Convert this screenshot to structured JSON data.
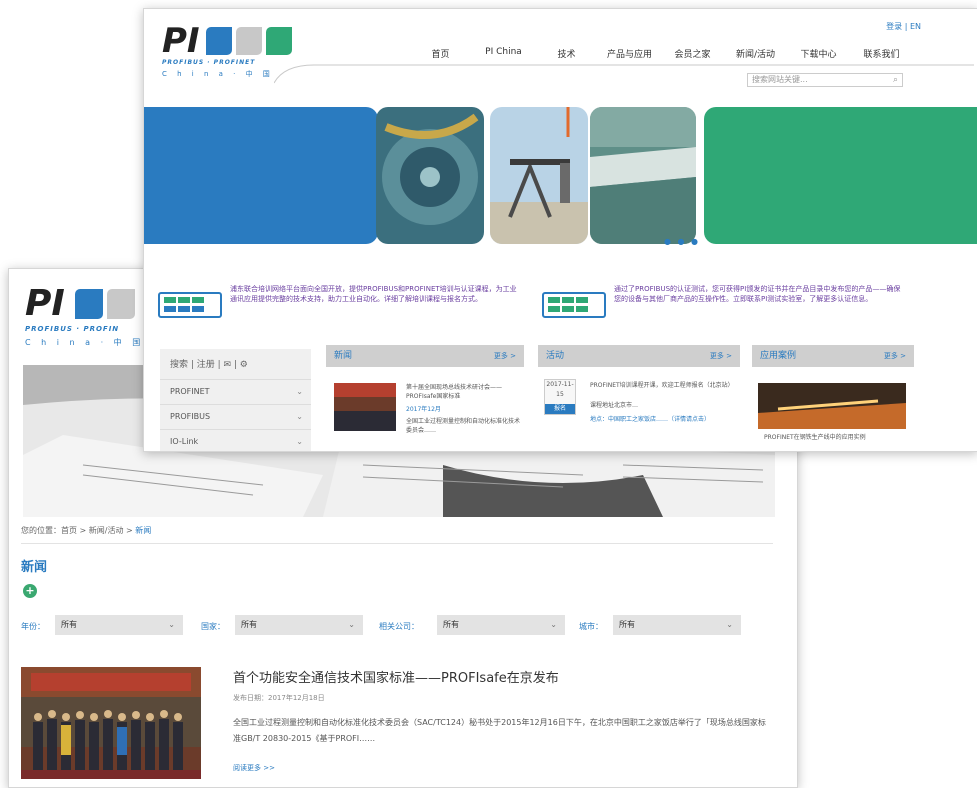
{
  "colors": {
    "brand_blue": "#2a7bc0",
    "brand_green": "#2fa876",
    "gray": "#c8c8c8",
    "purple_text": "#6a3fa0"
  },
  "back": {
    "logo": {
      "mark": "PI",
      "sub": "PROFIBUS · PROFIN",
      "cn": "C h i n a · 中 国"
    },
    "breadcrumb": {
      "prefix": "您的位置：",
      "home": "首页",
      "sep1": " > ",
      "section": "新闻/活动",
      "sep2": " > ",
      "current": "新闻"
    },
    "section_title": "新闻",
    "add_icon": "plus-icon",
    "filters": [
      {
        "label": "年份：",
        "value": "所有"
      },
      {
        "label": "国家：",
        "value": "所有"
      },
      {
        "label": "相关公司：",
        "value": "所有"
      },
      {
        "label": "城市：",
        "value": "所有"
      }
    ],
    "article": {
      "title": "首个功能安全通信技术国家标准——PROFIsafe在京发布",
      "date": "发布日期：2017年12月18日",
      "body": "全国工业过程测量控制和自动化标准化技术委员会（SAC/TC124）秘书处于2015年12月16日下午，在北京中国职工之家饭店举行了「现场总线国家标准GB/T 20830-2015《基于PROFI……",
      "more": "阅读更多 >>"
    }
  },
  "front": {
    "logo": {
      "mark": "PI",
      "sub": "PROFIBUS · PROFINET",
      "cn": "C h i n a · 中 国"
    },
    "top_links": {
      "login": "登录",
      "sep": " | ",
      "english": "EN"
    },
    "nav": [
      "首页",
      "PI China",
      "技术",
      "产品与应用",
      "会员之家",
      "新闻/活动",
      "下载中心",
      "联系我们"
    ],
    "search": {
      "placeholder": "搜索网站关键...",
      "icon": "search-icon"
    },
    "banner_dots": "● ● ●",
    "promo_left": "浦东联合培训网络平台面向全国开放，提供PROFIBUS和PROFINET培训与认证课程，为工业通讯应用提供完整的技术支持，助力工业自动化。详细了解培训课程与报名方式。",
    "promo_right": "通过了PROFIBUS的认证测试，您可获得PI颁发的证书并在产品目录中发布您的产品——确保您的设备与其他厂商产品的互操作性。立即联系PI测试实验室，了解更多认证信息。",
    "sidebar": {
      "tools": "搜索 | 注册 | ✉ | ⚙",
      "items": [
        "PROFINET",
        "PROFIBUS",
        "IO-Link"
      ]
    },
    "columns": [
      {
        "title": "新闻",
        "more": "更多 >"
      },
      {
        "title": "活动",
        "more": "更多 >"
      },
      {
        "title": "应用案例",
        "more": "更多 >"
      }
    ],
    "news_item": {
      "title": "第十届全国现场总线技术研讨会——PROFIsafe国家标准",
      "date": "2017年12月",
      "desc": "全国工业过程测量控制和自动化标准化技术委员会……"
    },
    "event_item": {
      "date": "2017-11-15",
      "tag": "报名",
      "title": "PROFINET培训课程开课，欢迎工程师报名（北京站）",
      "sub": "课程地址北京市…",
      "desc": "地点：中国职工之家饭店……（详情请点击）"
    },
    "case_item": {
      "title": "PROFINET在钢铁生产线中的应用实例"
    }
  }
}
